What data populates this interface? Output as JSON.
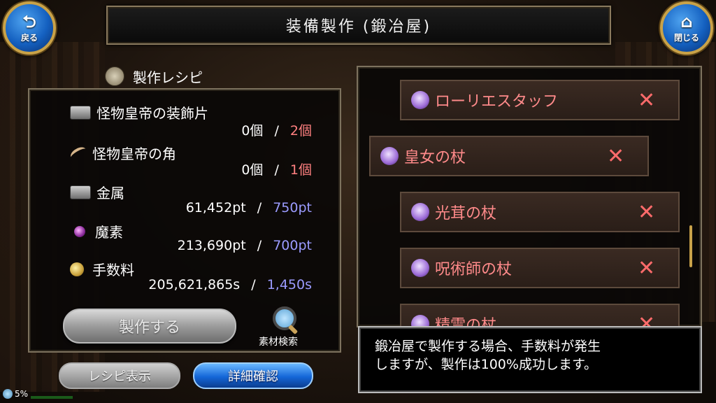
{
  "header": {
    "title": "装備製作 (鍛冶屋)",
    "back_label": "戻る",
    "close_label": "閉じる"
  },
  "recipe": {
    "header": "製作レシピ",
    "materials": [
      {
        "name": "怪物皇帝の装飾片",
        "icon": "gray-box-icon",
        "have": "0個",
        "need": "2個",
        "need_color": "#ff8080"
      },
      {
        "name": "怪物皇帝の角",
        "icon": "horn-icon",
        "have": "0個",
        "need": "1個",
        "need_color": "#ff8080"
      },
      {
        "name": "金属",
        "icon": "metal-icon",
        "have": "61,452pt",
        "need": "750pt",
        "need_color": "#9b9bff"
      },
      {
        "name": "魔素",
        "icon": "magic-orb-icon",
        "have": "213,690pt",
        "need": "700pt",
        "need_color": "#9b9bff"
      },
      {
        "name": "手数料",
        "icon": "coin-icon",
        "have": "205,621,865s",
        "need": "1,450s",
        "need_color": "#9b9bff"
      }
    ],
    "separator": "/",
    "craft_label": "製作する",
    "search_label": "素材検索"
  },
  "buttons": {
    "recipe_display": "レシピ表示",
    "details": "詳細確認"
  },
  "list": {
    "items": [
      {
        "name": "ローリエスタッフ",
        "mark": "✕",
        "selected": false
      },
      {
        "name": "皇女の杖",
        "mark": "✕",
        "selected": true
      },
      {
        "name": "光茸の杖",
        "mark": "✕",
        "selected": false
      },
      {
        "name": "呪術師の杖",
        "mark": "✕",
        "selected": false
      },
      {
        "name": "精霊の杖",
        "mark": "✕",
        "selected": false
      }
    ]
  },
  "message": {
    "line1": "鍛冶屋で製作する場合、手数料が発生",
    "line2": "しますが、製作は100%成功します。"
  },
  "status": {
    "percent": "5%"
  }
}
